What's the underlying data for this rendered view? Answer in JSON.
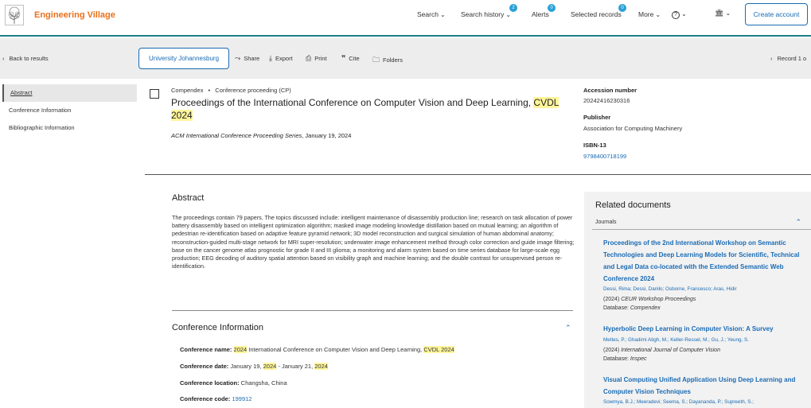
{
  "header": {
    "brand": "Engineering Village",
    "nav": {
      "search": "Search",
      "search_history": "Search history",
      "search_history_count": "2",
      "alerts": "Alerts",
      "alerts_count": "0",
      "selected_records": "Selected records",
      "selected_records_count": "0",
      "more": "More",
      "help": "?",
      "institution": "🏛"
    },
    "create_account": "Create account"
  },
  "toolbar": {
    "back": "Back to results",
    "institution_button": "University Johannesburg",
    "share": "Share",
    "export": "Export",
    "print": "Print",
    "cite": "Cite",
    "folders": "Folders",
    "record": "Record 1 o"
  },
  "sidenav": [
    "Abstract",
    "Conference Information",
    "Bibliographic Information"
  ],
  "record": {
    "database": "Compendex",
    "doc_type": "Conference proceeding (CP)",
    "title_part1": "Proceedings of the International Conference on Computer Vision and Deep Learning, ",
    "title_hl1": "CVDL",
    "title_space": " ",
    "title_hl2": "2024",
    "series": "ACM International Conference Proceeding Series",
    "series_date": ", January 19, 2024"
  },
  "details": {
    "accession_label": "Accession number",
    "accession_value": "20242416230316",
    "publisher_label": "Publisher",
    "publisher_value": "Association for Computing Machinery",
    "isbn_label": "ISBN-13",
    "isbn_value": "9798400718199"
  },
  "abstract": {
    "heading": "Abstract",
    "text": "The proceedings contain 79 papers. The topics discussed include: intelligent maintenance of disassembly production line; research on task allocation of power battery disassembly based on intelligent optimization algorithm; masked image modeling knowledge distillation based on mutual learning; an algorithm of pedestrian re-identification based on adaptive feature pyramid network; 3D model reconstruction and surgical simulation of human abdominal anatomy; reconstruction-guided multi-stage network for MRI super-resolution; underwater image enhancement method through color correction and guide image filtering; base on the cancer genome atlas prognostic for grade II and III glioma; a monitoring and alarm system based on time series database for large-scale egg production; EEG decoding of auditory spatial attention based on visibility graph and machine learning; and the double contrast for unsupervised person re-identification."
  },
  "conference": {
    "heading": "Conference Information",
    "name_label": "Conference name:",
    "name_hl1": "2024",
    "name_mid": " International Conference on Computer Vision and Deep Learning, ",
    "name_hl2": "CVDL 2024",
    "date_label": "Conference date:",
    "date_a": " January 19, ",
    "date_hl1": "2024",
    "date_b": " - January 21, ",
    "date_hl2": "2024",
    "location_label": "Conference location:",
    "location_value": " Changsha, China",
    "code_label": "Conference code:",
    "code_value": "199912"
  },
  "related": {
    "heading": "Related documents",
    "section": "Journals",
    "items": [
      {
        "title": "Proceedings of the 2nd International Workshop on Semantic Technologies and Deep Learning Models for Scientific, Technical and Legal Data co-located with the Extended Semantic Web Conference 2024",
        "authors": "Dessi, Rima; Dessi, Danilo; Osborne, Francesco; Aras, Hidir",
        "year": "(2024) ",
        "source": "CEUR Workshop Proceedings",
        "database_label": "Database: ",
        "database": "Compendex"
      },
      {
        "title": "Hyperbolic Deep Learning in Computer Vision: A Survey",
        "authors": "Mettes, P.; Ghadimi Atigh, M.; Keller-Ressel, M.;     Gu, J.;     Yeung, S.",
        "year": "(2024) ",
        "source": "International Journal of Computer Vision",
        "database_label": "Database: ",
        "database": "Inspec"
      },
      {
        "title": "Visual Computing Unified Application Using Deep Learning and Computer Vision Techniques",
        "authors": "Sowmya, B.J.; Meeradevi; Seema, S.; Dayananda, P.; Supreeth, S.;",
        "year": "",
        "source": "",
        "database_label": "",
        "database": ""
      }
    ]
  },
  "colors": {
    "brand": "#e9711c",
    "link": "#1a6bb4",
    "highlight": "#fff59a",
    "badge": "#29a0d8"
  }
}
